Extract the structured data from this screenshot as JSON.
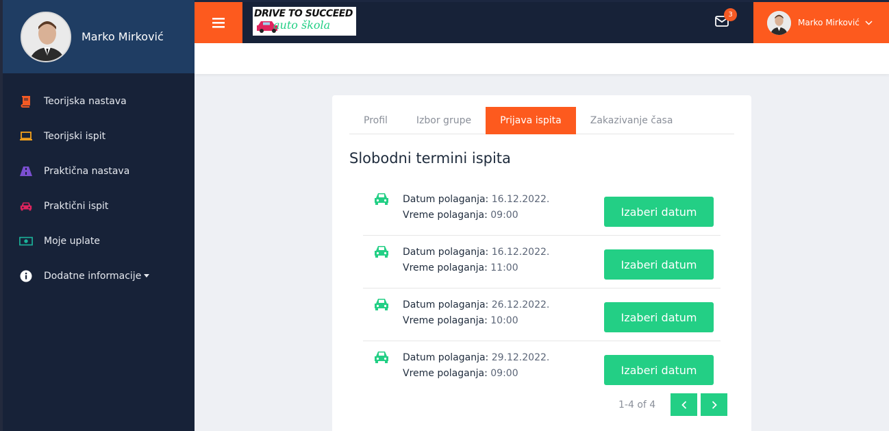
{
  "user": {
    "name": "Marko Mirković"
  },
  "sidebar": {
    "items": [
      {
        "label": "Teorijska nastava",
        "icon": "book-icon",
        "color": "#f45a24"
      },
      {
        "label": "Teorijski ispit",
        "icon": "laptop-icon",
        "color": "#f4a11c"
      },
      {
        "label": "Praktična nastava",
        "icon": "road-icon",
        "color": "#7a4fd0"
      },
      {
        "label": "Praktični ispit",
        "icon": "car-icon",
        "color": "#e0245e"
      },
      {
        "label": "Moje uplate",
        "icon": "money-icon",
        "color": "#1bb39a"
      },
      {
        "label": "Dodatne informacije",
        "icon": "info-icon",
        "color": "#ffffff"
      }
    ]
  },
  "topbar": {
    "logo_text_1": "DRIVE TO SUCCEED",
    "logo_text_2": "auto škola",
    "mail_count": "3",
    "user_name": "Marko Mirković"
  },
  "tabs": [
    {
      "label": "Profil",
      "active": false
    },
    {
      "label": "Izbor grupe",
      "active": false
    },
    {
      "label": "Prijava ispita",
      "active": true
    },
    {
      "label": "Zakazivanje časa",
      "active": false
    }
  ],
  "section_title": "Slobodni termini ispita",
  "slot_labels": {
    "date": "Datum polaganja:",
    "time": "Vreme polaganja:",
    "button": "Izaberi datum"
  },
  "slots": [
    {
      "date": "16.12.2022.",
      "time": "09:00"
    },
    {
      "date": "16.12.2022.",
      "time": "11:00"
    },
    {
      "date": "26.12.2022.",
      "time": "10:00"
    },
    {
      "date": "29.12.2022.",
      "time": "09:00"
    }
  ],
  "pager": {
    "text": "1-4 of 4"
  },
  "colors": {
    "accent": "#fd5a1e",
    "green": "#23cf85",
    "sidebar_bg": "#172238"
  }
}
